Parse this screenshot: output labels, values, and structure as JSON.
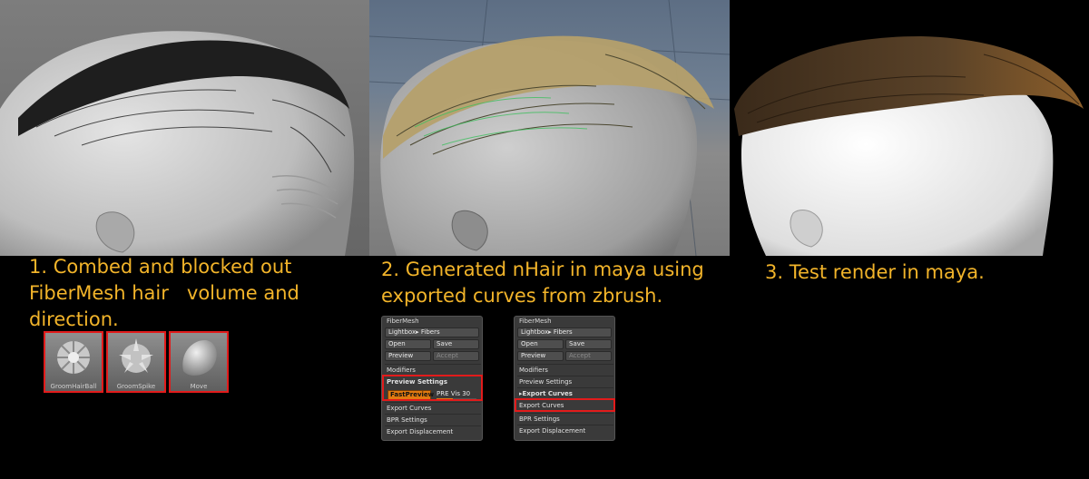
{
  "captions": {
    "step1_line1": "1. Combed and blocked out",
    "step1_line2": "FiberMesh hair   volume and",
    "step1_line3": "direction.",
    "step2_line1": "2. Generated nHair in maya using",
    "step2_line2": "exported curves from zbrush.",
    "step3": "3. Test render in maya."
  },
  "colors": {
    "caption": "#f2b42a",
    "highlight": "#e21b1b",
    "fast_preview": "#e07a10"
  },
  "brushes": [
    {
      "label": "GroomHairBall",
      "icon": "hair-ball-brush-icon"
    },
    {
      "label": "GroomSpike",
      "icon": "spike-brush-icon"
    },
    {
      "label": "Move",
      "icon": "move-brush-icon"
    }
  ],
  "palette_left": {
    "title": "FiberMesh",
    "lightbox": "Lightbox▸ Fibers",
    "open": "Open",
    "save": "Save",
    "preview": "Preview",
    "accept": "Accept",
    "modifiers": "Modifiers",
    "preview_settings": "Preview Settings",
    "fast_preview": "FastPreview",
    "pre_vis_label": "PRE Vis",
    "pre_vis_value": "30",
    "export_curves": "Export Curves",
    "bpr_settings": "BPR Settings",
    "export_displacement": "Export Displacement"
  },
  "palette_right": {
    "title": "FiberMesh",
    "lightbox": "Lightbox▸ Fibers",
    "open": "Open",
    "save": "Save",
    "preview": "Preview",
    "accept": "Accept",
    "modifiers": "Modifiers",
    "preview_settings": "Preview Settings",
    "export_curves_header": "▸Export Curves",
    "export_curves": "Export Curves",
    "bpr_settings": "BPR Settings",
    "export_displacement": "Export Displacement"
  }
}
